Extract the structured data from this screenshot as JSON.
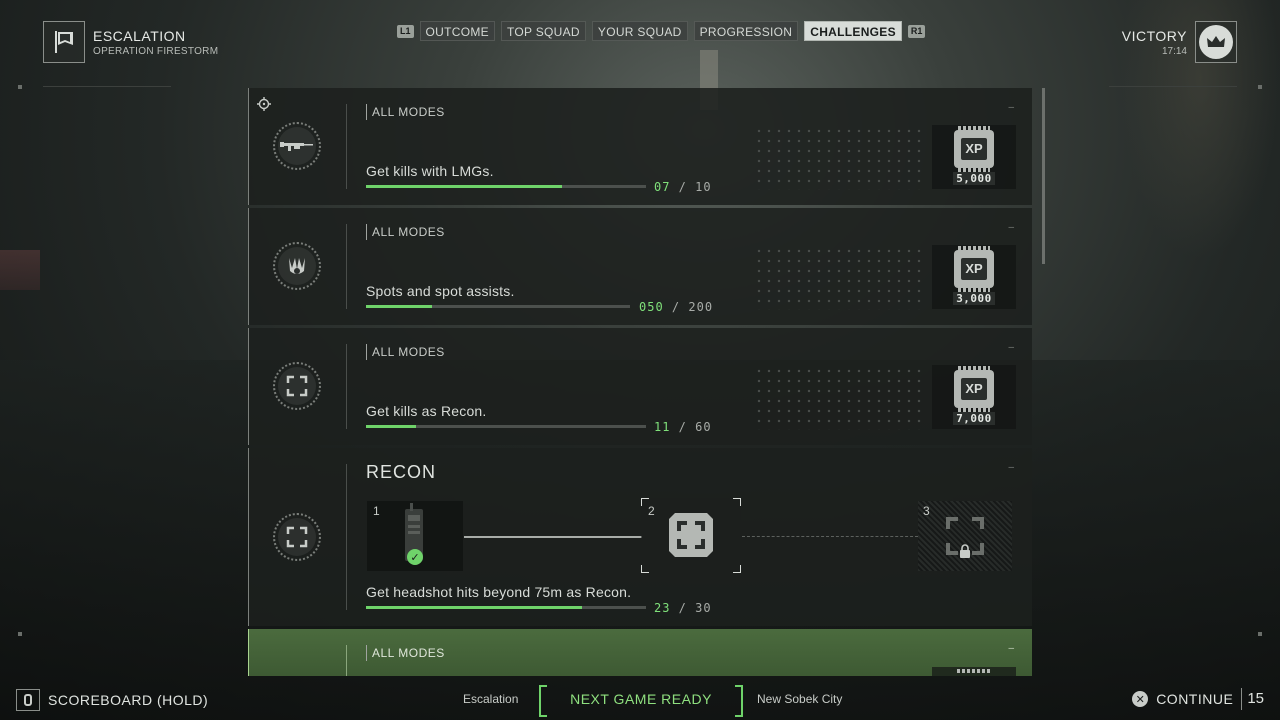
{
  "header": {
    "mode_title": "ESCALATION",
    "mode_subtitle": "OPERATION FIRESTORM",
    "result_title": "VICTORY",
    "result_time": "17:14",
    "left_bumper": "L1",
    "right_bumper": "R1",
    "tabs": [
      {
        "label": "OUTCOME",
        "active": false
      },
      {
        "label": "TOP SQUAD",
        "active": false
      },
      {
        "label": "YOUR SQUAD",
        "active": false
      },
      {
        "label": "PROGRESSION",
        "active": false
      },
      {
        "label": "CHALLENGES",
        "active": true
      }
    ]
  },
  "challenges": [
    {
      "modes": "ALL MODES",
      "icon": "lmg-icon",
      "description": "Get kills with LMGs.",
      "progress_current": "07",
      "progress_total": "10",
      "progress_fraction": 0.7,
      "reward_label": "XP",
      "reward_amount": "5,000"
    },
    {
      "modes": "ALL MODES",
      "icon": "spot-claw-icon",
      "description": "Spots and spot assists.",
      "progress_current": "050",
      "progress_total": "200",
      "progress_fraction": 0.25,
      "reward_label": "XP",
      "reward_amount": "3,000"
    },
    {
      "modes": "ALL MODES",
      "icon": "recon-class-icon",
      "description": "Get kills as Recon.",
      "progress_current": "11",
      "progress_total": "60",
      "progress_fraction": 0.18,
      "reward_label": "XP",
      "reward_amount": "7,000"
    }
  ],
  "tier_challenge": {
    "title": "RECON",
    "icon": "recon-class-icon",
    "tiers": [
      {
        "number": "1",
        "state": "completed"
      },
      {
        "number": "2",
        "state": "active"
      },
      {
        "number": "3",
        "state": "locked"
      }
    ],
    "description": "Get headshot hits beyond 75m as Recon.",
    "progress_current": "23",
    "progress_total": "30",
    "progress_fraction": 0.77
  },
  "next_card": {
    "modes": "ALL MODES"
  },
  "footer": {
    "scoreboard_label": "SCOREBOARD (HOLD)",
    "mode": "Escalation",
    "status": "NEXT GAME READY",
    "map": "New Sobek City",
    "continue_label": "CONTINUE",
    "countdown": "15"
  },
  "colors": {
    "accent_green": "#6fd36a",
    "active_tab": "#d8dcd8"
  }
}
